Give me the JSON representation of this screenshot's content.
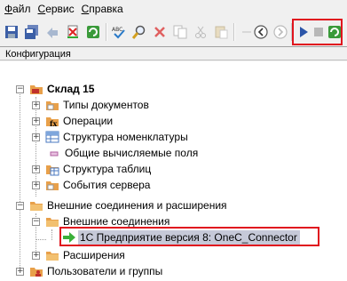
{
  "menu": [
    "Файл",
    "Сервис",
    "Справка"
  ],
  "panel_title": "Конфигурация",
  "tree": {
    "root": "Склад 15",
    "items": [
      "Типы документов",
      "Операции",
      "Структура номенклатуры",
      "Общие вычисляемые поля",
      "Структура таблиц",
      "События сервера"
    ],
    "ext_group": "Внешние соединения и расширения",
    "ext_conn": "Внешние соединения",
    "connector": "1С Предприятие версия 8: OneC_Connector",
    "extensions": "Расширения",
    "users": "Пользователи и группы"
  },
  "colors": {
    "highlight_border": "#e0141e",
    "selection": "#c6c9d8",
    "play": "#2b55a8"
  }
}
